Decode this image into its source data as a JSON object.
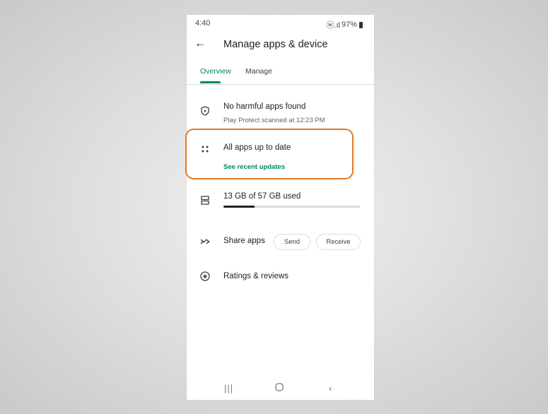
{
  "status_bar": {
    "time": "4:40",
    "signal": "ⓦ.ıl",
    "battery": "97%"
  },
  "app_bar": {
    "back_icon": "arrow-back-icon",
    "title": "Manage apps & device"
  },
  "tabs": [
    {
      "label": "Overview",
      "active": true
    },
    {
      "label": "Manage",
      "active": false
    }
  ],
  "protect": {
    "icon": "play-protect-icon",
    "title": "No harmful apps found",
    "subtitle": "Play Protect scanned at 12:23 PM"
  },
  "updates": {
    "icon": "apps-grid-icon",
    "title": "All apps up to date",
    "link": "See recent updates"
  },
  "storage": {
    "icon": "storage-icon",
    "label": "13 GB of 57 GB used",
    "used_gb": 13,
    "total_gb": 57
  },
  "share": {
    "icon": "share-apps-icon",
    "label": "Share apps",
    "send_label": "Send",
    "receive_label": "Receive"
  },
  "ratings": {
    "icon": "ratings-star-icon",
    "label": "Ratings & reviews"
  },
  "nav_bar": {
    "recents_icon": "recents-icon",
    "home_icon": "home-icon",
    "back_icon": "nav-back-icon"
  },
  "colors": {
    "accent": "#01875f",
    "highlight": "#e07a26"
  }
}
